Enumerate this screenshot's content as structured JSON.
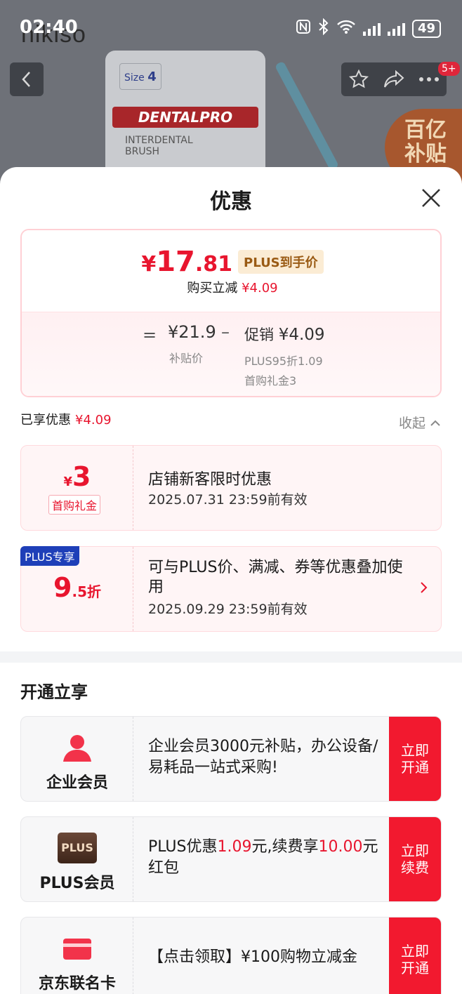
{
  "status_bar": {
    "time": "02:40",
    "battery": "49"
  },
  "background": {
    "brand": "nikiso",
    "product_size_label": "Size",
    "product_size_value": "4",
    "product_band": "DENTALPRO",
    "product_text": "INTERDENTAL\nBRUSH",
    "promo_badge": "百亿\n补贴",
    "more_badge": "5+"
  },
  "sheet": {
    "title": "优惠",
    "price_card": {
      "currency": "¥",
      "price_int": "17",
      "price_dec": ".81",
      "plus_tag": "PLUS到手价",
      "reduce_label": "购买立减",
      "reduce_amount": "¥4.09",
      "eq": "=",
      "subsidy_price": "¥21.9",
      "subsidy_label": "补贴价",
      "minus": "–",
      "promo_label": "促销",
      "promo_amount": "¥4.09",
      "detail_1": "PLUS95折1.09",
      "detail_2": "首购礼金3"
    },
    "enjoyed_label": "已享优惠",
    "enjoyed_amount": "¥4.09",
    "collapse_label": "收起",
    "coupons": [
      {
        "currency": "¥",
        "value": "3",
        "tag": "首购礼金",
        "title": "店铺新客限时优惠",
        "date": "2025.07.31 23:59前有效"
      },
      {
        "badge": "PLUS专享",
        "value_int": "9",
        "value_dec": ".5折",
        "text": "可与PLUS价、满减、券等优惠叠加使用",
        "date": "2025.09.29 23:59前有效"
      }
    ],
    "section_title": "开通立享",
    "members": [
      {
        "name": "企业会员",
        "text": " 企业会员3000元补贴，办公设备/易耗品一站式采购!",
        "button": "立即开通"
      },
      {
        "name": "PLUS会员",
        "logo": "PLUS",
        "text_a": "PLUS优惠",
        "text_b": "1.09",
        "text_c": "元,续费享",
        "text_d": "10.00",
        "text_e": "元红包",
        "button": "立即续费"
      },
      {
        "name": "京东联名卡",
        "text": "【点击领取】¥100购物立减金",
        "button": "立即开通"
      }
    ]
  },
  "colors": {
    "accent": "#e8152e",
    "plus_blue": "#1e3fb8",
    "button_red": "#f2192f"
  }
}
